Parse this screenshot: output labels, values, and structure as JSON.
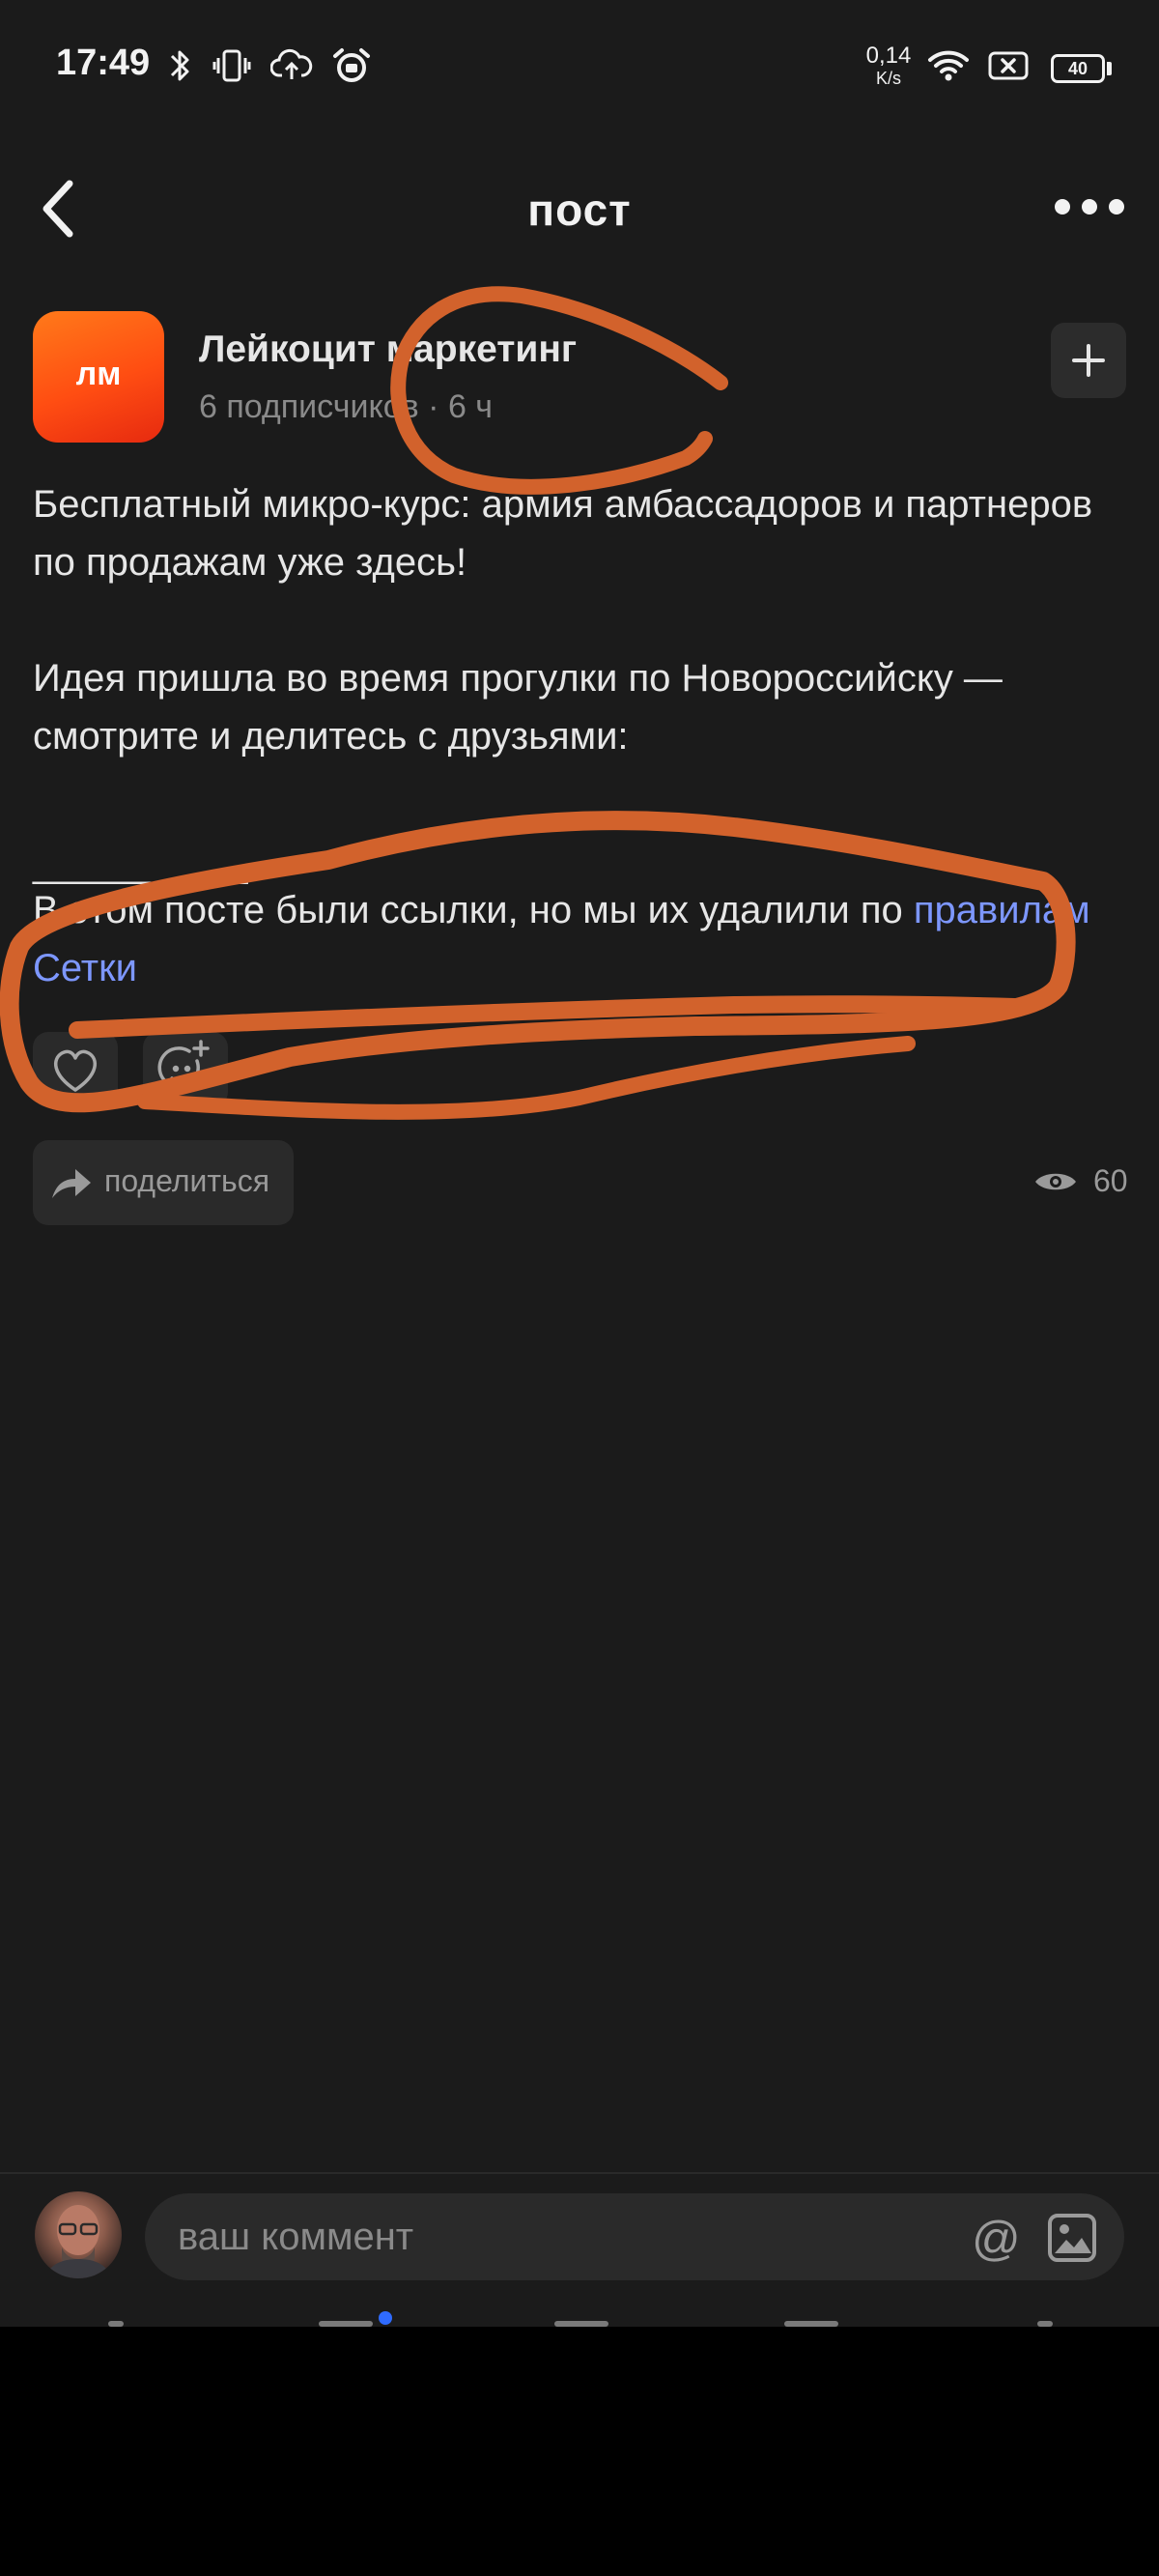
{
  "status_bar": {
    "time": "17:49",
    "net_speed_value": "0,14",
    "net_speed_unit": "K/s",
    "battery_level": "40",
    "icons": [
      "bluetooth-icon",
      "vibrate-icon",
      "cloud-upload-icon",
      "alarm-icon",
      "wifi-icon",
      "sim-x-icon",
      "battery-icon"
    ]
  },
  "header": {
    "title": "пост",
    "back_icon": "chevron-left-icon",
    "more_icon": "more-dots-icon"
  },
  "author": {
    "avatar_text": "лм",
    "name": "Лейкоцит маркетинг",
    "meta": "6 подписчиков · 6 ч",
    "follow_icon": "plus-icon"
  },
  "post": {
    "paragraph1": "Бесплатный микро-курс: армия амбассадоров и партнеров по продажам уже здесь!",
    "paragraph2": "Идея пришла во время прогулки по Новороссийску — смотрите и делитесь с друзьями:",
    "divider": "__________",
    "removed_note": "В этом посте были ссылки, но мы их удалили по ",
    "rules_link": "правилам Сетки"
  },
  "actions": {
    "like_icon": "heart-icon",
    "add_reaction_icon": "add-emoji-icon",
    "share_label": "поделиться",
    "share_icon": "share-arrow-icon",
    "views_icon": "eye-icon",
    "views_count": "60"
  },
  "comment_bar": {
    "placeholder": "ваш коммент",
    "mention_symbol": "@",
    "image_icon": "image-icon"
  },
  "colors": {
    "background": "#1b1b1b",
    "accent_link": "#7d97ff",
    "avatar_gradient": "#ff4d12",
    "annotation": "#d2622c",
    "nav_dot": "#2f6bff"
  }
}
